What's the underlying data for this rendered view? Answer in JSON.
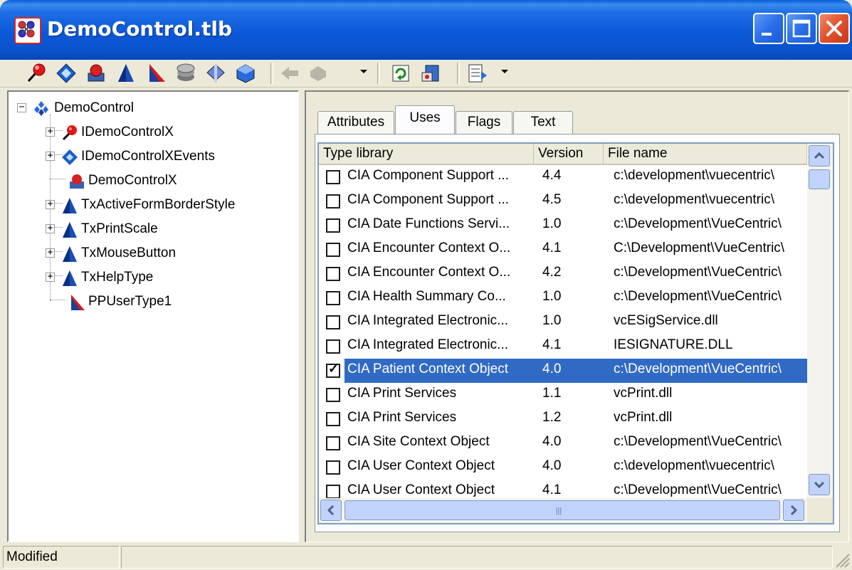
{
  "window": {
    "title": "DemoControl.tlb"
  },
  "toolbar": {
    "buttons": [
      {
        "name": "new-interface",
        "icon": "red-pin-icon",
        "enabled": true
      },
      {
        "name": "new-dispinterface",
        "icon": "blue-diamond-icon",
        "enabled": true
      },
      {
        "name": "new-coclass",
        "icon": "coclass-icon",
        "enabled": true
      },
      {
        "name": "new-enumeration",
        "icon": "blue-cone-icon",
        "enabled": true
      },
      {
        "name": "new-record",
        "icon": "record-icon",
        "enabled": true
      },
      {
        "name": "new-module",
        "icon": "stack-icon",
        "enabled": true
      },
      {
        "name": "new-union",
        "icon": "union-icon",
        "enabled": true
      },
      {
        "name": "new-alias",
        "icon": "alias-icon",
        "enabled": true
      },
      {
        "name": "new-method",
        "icon": "method-icon",
        "enabled": false
      },
      {
        "name": "new-property",
        "icon": "property-icon",
        "enabled": false
      },
      {
        "name": "refresh",
        "icon": "refresh-icon",
        "enabled": true
      },
      {
        "name": "register",
        "icon": "register-icon",
        "enabled": true
      },
      {
        "name": "export",
        "icon": "export-icon",
        "enabled": true
      }
    ]
  },
  "tree": {
    "items": [
      {
        "label": "DemoControl",
        "icon": "library-icon",
        "expander": "⊟",
        "level": 0
      },
      {
        "label": "IDemoControlX",
        "icon": "red-pin-icon",
        "expander": "+",
        "level": 1
      },
      {
        "label": "IDemoControlXEvents",
        "icon": "blue-diamond-icon",
        "expander": "+",
        "level": 1
      },
      {
        "label": "DemoControlX",
        "icon": "coclass-icon",
        "expander": "",
        "level": 1
      },
      {
        "label": "TxActiveFormBorderStyle",
        "icon": "blue-cone-icon",
        "expander": "+",
        "level": 1
      },
      {
        "label": "TxPrintScale",
        "icon": "blue-cone-icon",
        "expander": "+",
        "level": 1
      },
      {
        "label": "TxMouseButton",
        "icon": "blue-cone-icon",
        "expander": "+",
        "level": 1
      },
      {
        "label": "TxHelpType",
        "icon": "blue-cone-icon",
        "expander": "+",
        "level": 1
      },
      {
        "label": "PPUserType1",
        "icon": "record-icon",
        "expander": "",
        "level": 1
      }
    ]
  },
  "tabs": [
    {
      "label": "Attributes",
      "active": false
    },
    {
      "label": "Uses",
      "active": true
    },
    {
      "label": "Flags",
      "active": false
    },
    {
      "label": "Text",
      "active": false
    }
  ],
  "uses_list": {
    "columns": [
      "Type library",
      "Version",
      "File name"
    ],
    "rows": [
      {
        "checked": false,
        "name": "CIA Component Support ...",
        "version": "4.4",
        "file": "c:\\development\\vuecentric\\"
      },
      {
        "checked": false,
        "name": "CIA Component Support ...",
        "version": "4.5",
        "file": "c:\\development\\vuecentric\\"
      },
      {
        "checked": false,
        "name": "CIA Date Functions Servi...",
        "version": "1.0",
        "file": "c:\\Development\\VueCentric\\"
      },
      {
        "checked": false,
        "name": "CIA Encounter Context O...",
        "version": "4.1",
        "file": "C:\\Development\\VueCentric\\"
      },
      {
        "checked": false,
        "name": "CIA Encounter Context O...",
        "version": "4.2",
        "file": "c:\\Development\\VueCentric\\"
      },
      {
        "checked": false,
        "name": "CIA Health Summary Co...",
        "version": "1.0",
        "file": "c:\\Development\\VueCentric\\"
      },
      {
        "checked": false,
        "name": "CIA Integrated Electronic...",
        "version": "1.0",
        "file": "vcESigService.dll"
      },
      {
        "checked": false,
        "name": "CIA Integrated Electronic...",
        "version": "4.1",
        "file": "IESIGNATURE.DLL"
      },
      {
        "checked": true,
        "name": "CIA Patient Context Object",
        "version": "4.0",
        "file": "c:\\Development\\VueCentric\\",
        "selected": true
      },
      {
        "checked": false,
        "name": "CIA Print Services",
        "version": "1.1",
        "file": "vcPrint.dll"
      },
      {
        "checked": false,
        "name": "CIA Print Services",
        "version": "1.2",
        "file": "vcPrint.dll"
      },
      {
        "checked": false,
        "name": "CIA Site Context Object",
        "version": "4.0",
        "file": "c:\\Development\\VueCentric\\"
      },
      {
        "checked": false,
        "name": "CIA User Context Object",
        "version": "4.0",
        "file": "c:\\development\\vuecentric\\"
      },
      {
        "checked": false,
        "name": "CIA User Context Object",
        "version": "4.1",
        "file": "c:\\Development\\VueCentric\\"
      }
    ]
  },
  "status": {
    "text": "Modified",
    "panel2": ""
  },
  "colors": {
    "selection": "#316ac5",
    "titlebar": "#0a52cc",
    "window_bg": "#ece9d8"
  }
}
